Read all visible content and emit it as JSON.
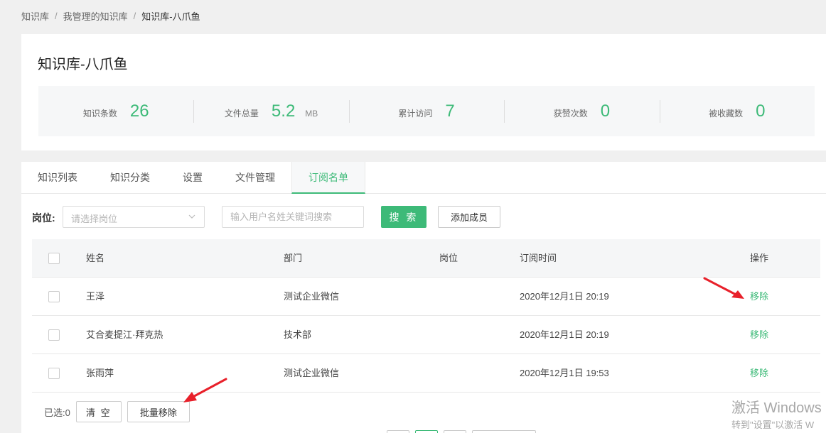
{
  "breadcrumb": {
    "items": [
      "知识库",
      "我管理的知识库",
      "知识库-八爪鱼"
    ],
    "separator": "/"
  },
  "page_title": "知识库-八爪鱼",
  "stats": [
    {
      "label": "知识条数",
      "value": "26",
      "unit": ""
    },
    {
      "label": "文件总量",
      "value": "5.2",
      "unit": "MB"
    },
    {
      "label": "累计访问",
      "value": "7",
      "unit": ""
    },
    {
      "label": "获赞次数",
      "value": "0",
      "unit": ""
    },
    {
      "label": "被收藏数",
      "value": "0",
      "unit": ""
    }
  ],
  "tabs": [
    {
      "label": "知识列表"
    },
    {
      "label": "知识分类"
    },
    {
      "label": "设置"
    },
    {
      "label": "文件管理"
    },
    {
      "label": "订阅名单"
    }
  ],
  "active_tab": "订阅名单",
  "filter": {
    "position_label": "岗位:",
    "position_placeholder": "请选择岗位",
    "keyword_placeholder": "输入用户名姓关键词搜索",
    "search_button": "搜 索",
    "add_member_button": "添加成员"
  },
  "table": {
    "headers": {
      "name": "姓名",
      "dept": "部门",
      "position": "岗位",
      "time": "订阅时间",
      "op": "操作"
    },
    "rows": [
      {
        "name": "王泽",
        "dept": "测试企业微信",
        "position": "",
        "time": "2020年12月1日 20:19",
        "op": "移除"
      },
      {
        "name": "艾合麦提江·拜克热",
        "dept": "技术部",
        "position": "",
        "time": "2020年12月1日 20:19",
        "op": "移除"
      },
      {
        "name": "张雨萍",
        "dept": "测试企业微信",
        "position": "",
        "time": "2020年12月1日 19:53",
        "op": "移除"
      }
    ]
  },
  "footer": {
    "selected_text": "已选:0",
    "clear_button": "清 空",
    "batch_remove_button": "批量移除"
  },
  "watermark": {
    "line1": "激活 Windows",
    "line2": "转到\"设置\"以激活 W"
  },
  "colors": {
    "accent": "#3dba78",
    "annotation_arrow": "#e8202a"
  },
  "icons": {
    "select_chevron": "chevron-down-icon"
  }
}
